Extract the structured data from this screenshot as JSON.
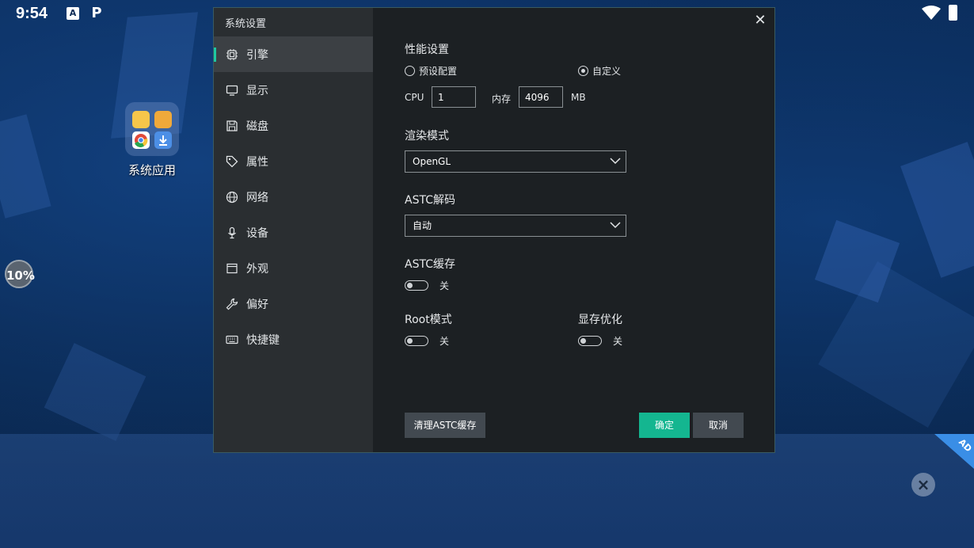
{
  "statusbar": {
    "time": "9:54",
    "icons": [
      "a-notification-icon",
      "p-notification-icon",
      "wifi-icon",
      "battery-icon"
    ]
  },
  "desktop": {
    "folder_label": "系统应用",
    "progress_badge": "10%",
    "ad_tag": "AD"
  },
  "dialog": {
    "title": "系统设置",
    "close_icon": "close-icon",
    "nav": [
      {
        "label": "引擎",
        "icon": "chip-icon",
        "active": true
      },
      {
        "label": "显示",
        "icon": "monitor-icon",
        "active": false
      },
      {
        "label": "磁盘",
        "icon": "disk-icon",
        "active": false
      },
      {
        "label": "属性",
        "icon": "tag-icon",
        "active": false
      },
      {
        "label": "网络",
        "icon": "globe-icon",
        "active": false
      },
      {
        "label": "设备",
        "icon": "microphone-icon",
        "active": false
      },
      {
        "label": "外观",
        "icon": "window-icon",
        "active": false
      },
      {
        "label": "偏好",
        "icon": "wrench-icon",
        "active": false
      },
      {
        "label": "快捷键",
        "icon": "keyboard-icon",
        "active": false
      }
    ],
    "performance": {
      "title": "性能设置",
      "preset_label": "预设配置",
      "custom_label": "自定义",
      "selected": "custom",
      "cpu_label": "CPU",
      "cpu_value": "1",
      "memory_label": "内存",
      "memory_value": "4096",
      "memory_unit": "MB"
    },
    "render": {
      "title": "渲染模式",
      "value": "OpenGL"
    },
    "astc_decode": {
      "title": "ASTC解码",
      "value": "自动"
    },
    "astc_cache": {
      "title": "ASTC缓存",
      "state": "关"
    },
    "root_mode": {
      "title": "Root模式",
      "state": "关"
    },
    "vram_opt": {
      "title": "显存优化",
      "state": "关"
    },
    "buttons": {
      "clear_astc": "清理ASTC缓存",
      "ok": "确定",
      "cancel": "取消"
    },
    "colors": {
      "accent": "#14b690",
      "sidebar": "#2a2e31",
      "panel": "#1c2023"
    }
  }
}
